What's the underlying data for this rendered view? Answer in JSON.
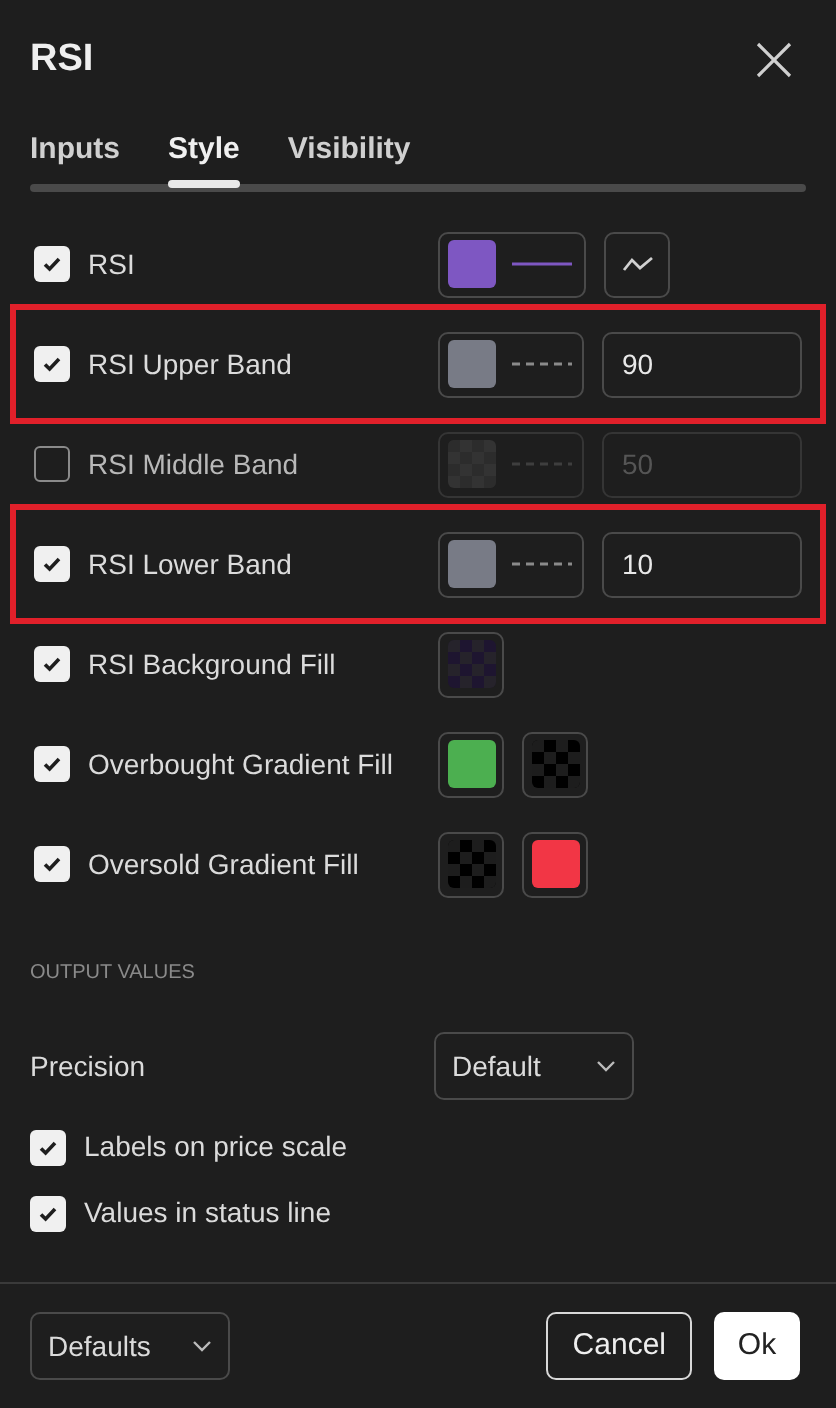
{
  "dialog": {
    "title": "RSI"
  },
  "tabs": [
    {
      "label": "Inputs",
      "selected": false
    },
    {
      "label": "Style",
      "selected": true
    },
    {
      "label": "Visibility",
      "selected": false
    }
  ],
  "style_rows": [
    {
      "kind": "line",
      "label": "RSI",
      "checked": true,
      "disabled": false,
      "highlighted": false,
      "color": "#7e57c2",
      "dashed": false
    },
    {
      "kind": "band",
      "label": "RSI Upper Band",
      "checked": true,
      "disabled": false,
      "highlighted": true,
      "color": "#787b86",
      "dashed": true,
      "value": "90"
    },
    {
      "kind": "band",
      "label": "RSI Middle Band",
      "checked": false,
      "disabled": true,
      "highlighted": false,
      "color": "#333333",
      "dashed": true,
      "value": "50"
    },
    {
      "kind": "band",
      "label": "RSI Lower Band",
      "checked": true,
      "disabled": false,
      "highlighted": true,
      "color": "#787b86",
      "dashed": true,
      "value": "10"
    },
    {
      "kind": "fill",
      "label": "RSI Background Fill",
      "checked": true,
      "highlighted": false,
      "swatches": [
        {
          "kind": "transparent",
          "color": "#1e1530"
        }
      ]
    },
    {
      "kind": "fill",
      "label": "Overbought Gradient Fill",
      "checked": true,
      "highlighted": false,
      "swatches": [
        {
          "kind": "solid",
          "color": "#4caf50"
        },
        {
          "kind": "transparent",
          "color": "#000000"
        }
      ]
    },
    {
      "kind": "fill",
      "label": "Oversold Gradient Fill",
      "checked": true,
      "highlighted": false,
      "swatches": [
        {
          "kind": "transparent",
          "color": "#000000"
        },
        {
          "kind": "solid",
          "color": "#f23645"
        }
      ]
    }
  ],
  "output_values": {
    "heading": "OUTPUT VALUES",
    "precision_label": "Precision",
    "precision_value": "Default",
    "options": [
      {
        "label": "Labels on price scale",
        "checked": true
      },
      {
        "label": "Values in status line",
        "checked": true
      }
    ]
  },
  "footer": {
    "defaults": "Defaults",
    "cancel": "Cancel",
    "ok": "Ok"
  }
}
